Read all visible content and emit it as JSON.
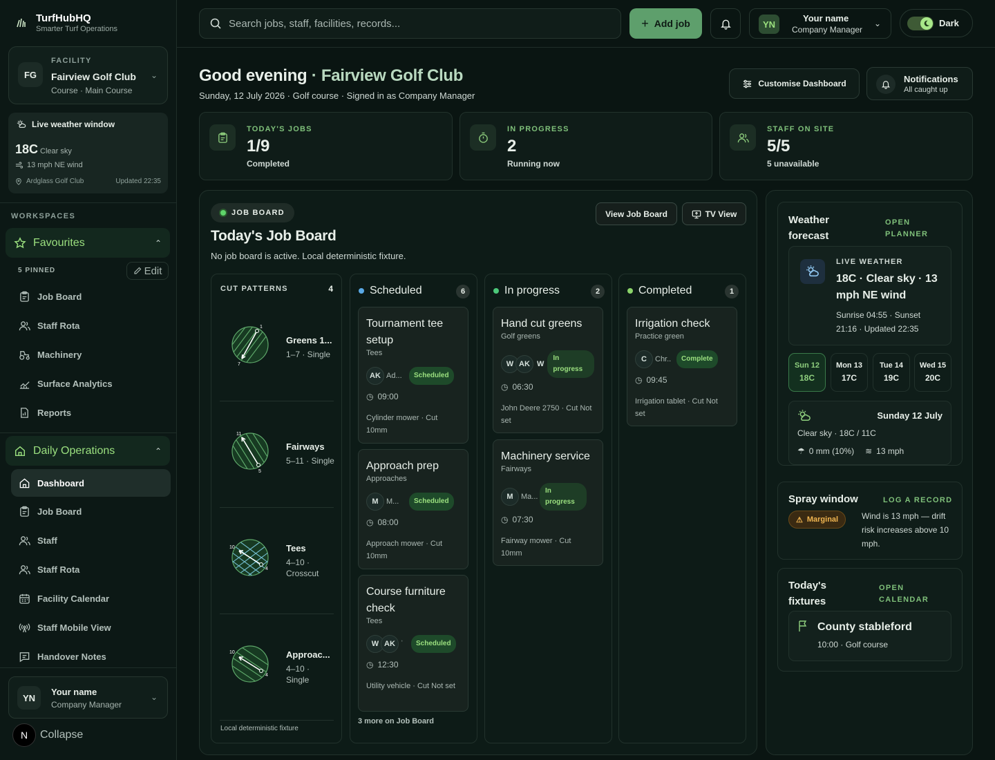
{
  "brand": {
    "name": "TurfHubHQ",
    "tagline": "Smarter Turf Operations"
  },
  "facility": {
    "label": "FACILITY",
    "initials": "FG",
    "name": "Fairview Golf Club",
    "sub": "Course · Main Course"
  },
  "weather_mini": {
    "title": "Live weather window",
    "temp": "18C",
    "condition": "Clear sky",
    "wind": "13 mph NE wind",
    "location": "Ardglass Golf Club",
    "updated": "Updated 22:35"
  },
  "sidebar": {
    "workspaces_label": "WORKSPACES",
    "favourites": {
      "label": "Favourites",
      "pinned": "5 PINNED",
      "edit": "Edit",
      "items": [
        "Job Board",
        "Staff Rota",
        "Machinery",
        "Surface Analytics",
        "Reports"
      ]
    },
    "daily_ops": {
      "label": "Daily Operations",
      "items": [
        "Dashboard",
        "Job Board",
        "Staff",
        "Staff Rota",
        "Facility Calendar",
        "Staff Mobile View",
        "Handover Notes"
      ]
    },
    "user": {
      "initials": "YN",
      "name": "Your name",
      "role": "Company Manager"
    },
    "collapse": {
      "badge": "N",
      "label": "Collapse"
    }
  },
  "topbar": {
    "search_placeholder": "Search jobs, staff, facilities, records...",
    "add_job": "Add job",
    "user": {
      "initials": "YN",
      "name": "Your name",
      "role": "Company Manager"
    },
    "theme": "Dark"
  },
  "header": {
    "greeting": "Good evening",
    "separator": " · ",
    "facility": "Fairview Golf Club",
    "subtitle": "Sunday, 12 July 2026 · Golf course · Signed in as Company Manager",
    "customise": "Customise Dashboard",
    "notif_title": "Notifications",
    "notif_sub": "All caught up"
  },
  "stats": [
    {
      "label": "TODAY'S JOBS",
      "value": "1/9",
      "sub": "Completed"
    },
    {
      "label": "IN PROGRESS",
      "value": "2",
      "sub": "Running now"
    },
    {
      "label": "STAFF ON SITE",
      "value": "5/5",
      "sub": "5 unavailable"
    }
  ],
  "job_board": {
    "pill": "JOB BOARD",
    "title": "Today's Job Board",
    "subtitle": "No job board is active. Local deterministic fixture.",
    "view_btn": "View Job Board",
    "tv_btn": "TV View",
    "cut_patterns": {
      "label": "CUT PATTERNS",
      "count": "4",
      "footer": "Local deterministic fixture",
      "items": [
        {
          "name": "Greens 1...",
          "desc": "1–7 · Single",
          "n1": "1",
          "n2": "7"
        },
        {
          "name": "Fairways",
          "desc": "5–11 · Single",
          "n1": "11",
          "n2": "5"
        },
        {
          "name": "Tees",
          "desc": "4–10 · Crosscut",
          "n1": "10",
          "n2": "4"
        },
        {
          "name": "Approac...",
          "desc": "4–10 · Single",
          "n1": "10",
          "n2": "4"
        }
      ]
    },
    "columns": {
      "scheduled": {
        "label": "Scheduled",
        "count": "6",
        "more": "3 more on Job Board",
        "cards": [
          {
            "title": "Tournament tee setup",
            "loc": "Tees",
            "av1": "AK",
            "av2": "",
            "pname": "Ad...",
            "badge": "Scheduled",
            "time": "09:00",
            "eq": "Cylinder mower · Cut 10mm"
          },
          {
            "title": "Approach prep",
            "loc": "Approaches",
            "av1": "M",
            "av2": "",
            "pname": "M...",
            "badge": "Scheduled",
            "time": "08:00",
            "eq": "Approach mower · Cut 10mm"
          },
          {
            "title": "Course furniture check",
            "loc": "Tees",
            "av1": "W",
            "av2": "AK",
            "pname": "",
            "badge": "Scheduled",
            "time": "12:30",
            "eq": "Utility vehicle · Cut Not set"
          }
        ]
      },
      "in_progress": {
        "label": "In progress",
        "count": "2",
        "cards": [
          {
            "title": "Hand cut greens",
            "loc": "Golf greens",
            "av1": "W",
            "av2": "AK",
            "av3": "W",
            "badge": "In progress",
            "time": "06:30",
            "eq": "John Deere 2750 · Cut Not set"
          },
          {
            "title": "Machinery service",
            "loc": "Fairways",
            "av1": "M",
            "pname": "Ma...",
            "badge": "In progress",
            "time": "07:30",
            "eq": "Fairway mower · Cut 10mm"
          }
        ]
      },
      "completed": {
        "label": "Completed",
        "count": "1",
        "cards": [
          {
            "title": "Irrigation check",
            "loc": "Practice green",
            "av1": "C",
            "pname": "Chr...",
            "badge": "Complete",
            "time": "09:45",
            "eq": "Irrigation tablet · Cut Not set"
          }
        ]
      }
    }
  },
  "weather": {
    "title": "Weather forecast",
    "link": "OPEN PLANNER",
    "live_label": "LIVE WEATHER",
    "live_main": "18C · Clear sky · 13 mph NE wind",
    "live_sub": "Sunrise 04:55 · Sunset 21:16 · Updated 22:35",
    "days": [
      {
        "name": "Sun 12",
        "temp": "18C"
      },
      {
        "name": "Mon 13",
        "temp": "17C"
      },
      {
        "name": "Tue 14",
        "temp": "19C"
      },
      {
        "name": "Wed 15",
        "temp": "20C"
      }
    ],
    "detail": {
      "date": "Sunday 12 July",
      "cond": "Clear sky · 18C / 11C",
      "rain": "0 mm (10%)",
      "wind": "13 mph"
    }
  },
  "spray": {
    "title": "Spray window",
    "link": "LOG A RECORD",
    "badge": "Marginal",
    "text": "Wind is 13 mph — drift risk increases above 10 mph."
  },
  "fixtures": {
    "title": "Today's fixtures",
    "link": "OPEN CALENDAR",
    "name": "County stableford",
    "sub": "10:00 · Golf course"
  },
  "colors": {
    "accent": "#9be07f",
    "brand_green": "#5e9f6c",
    "background": "#0a1512",
    "scheduled_dot": "#5aa9e6",
    "progress_dot": "#4cc87a",
    "completed_dot": "#8bd46a",
    "marginal": "#f0b550"
  }
}
